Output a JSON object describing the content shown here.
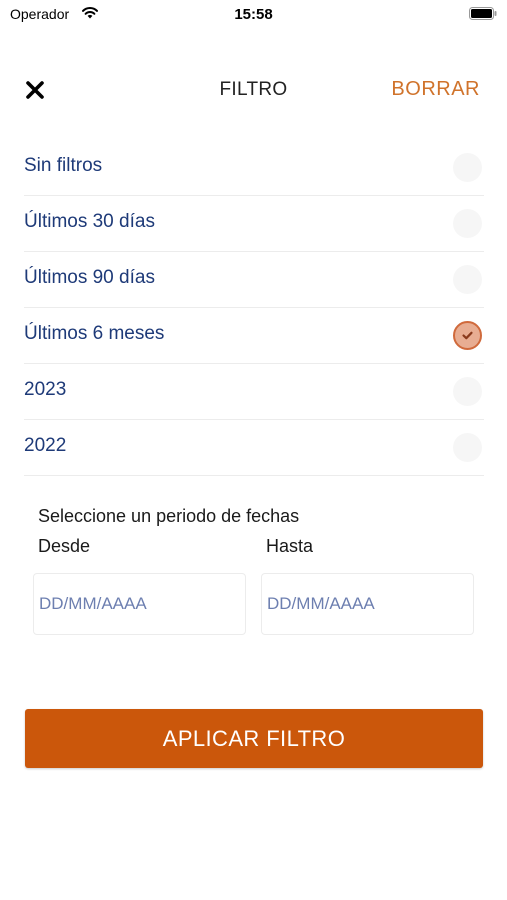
{
  "status_bar": {
    "carrier": "Operador",
    "time": "15:58",
    "icons": [
      "wifi-icon",
      "battery-icon"
    ]
  },
  "header": {
    "close_icon": "close-icon",
    "title": "FILTRO",
    "clear_label": "BORRAR"
  },
  "options": [
    {
      "label": "Sin filtros",
      "selected": false
    },
    {
      "label": "Últimos 30 días",
      "selected": false
    },
    {
      "label": "Últimos 90 días",
      "selected": false
    },
    {
      "label": "Últimos 6 meses",
      "selected": true
    },
    {
      "label": "2023",
      "selected": false
    },
    {
      "label": "2022",
      "selected": false
    }
  ],
  "date_range": {
    "title": "Seleccione un periodo de fechas",
    "from_label": "Desde",
    "to_label": "Hasta",
    "from_placeholder": "DD/MM/AAAA",
    "to_placeholder": "DD/MM/AAAA",
    "from_value": "",
    "to_value": ""
  },
  "apply_label": "APLICAR FILTRO",
  "colors": {
    "accent": "#cb570b",
    "clear_text": "#d0732b",
    "option_text": "#1e3a78",
    "selected_fill": "#e8ad92",
    "selected_border": "#d06a3c"
  }
}
